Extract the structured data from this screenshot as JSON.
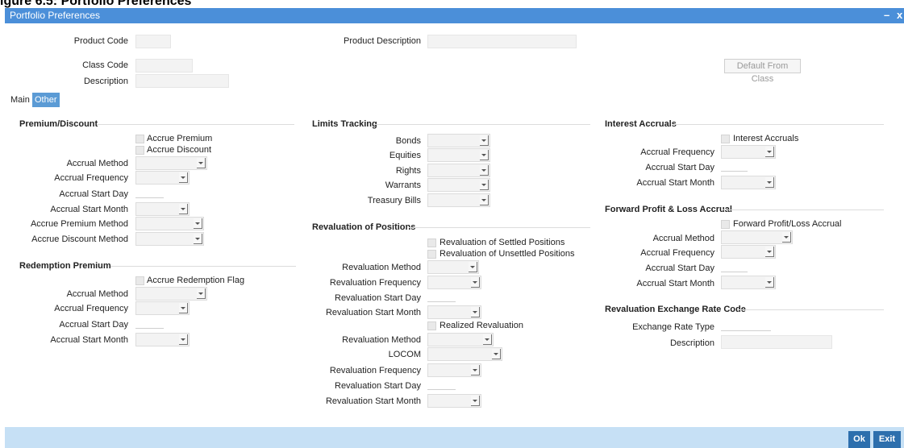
{
  "caption": "igure 6.5: Portfolio Preferences",
  "window": {
    "title": "Portfolio Preferences",
    "minimize": "–",
    "close": "x"
  },
  "header": {
    "product_code_label": "Product Code",
    "product_description_label": "Product Description",
    "class_code_label": "Class Code",
    "description_label": "Description",
    "default_from_class": "Default From Class"
  },
  "tabs": [
    {
      "label": "Main"
    },
    {
      "label": "Other"
    }
  ],
  "premium_discount": {
    "title": "Premium/Discount",
    "accrue_premium": "Accrue Premium",
    "accrue_discount": "Accrue Discount",
    "accrual_method": "Accrual Method",
    "accrual_frequency": "Accrual Frequency",
    "accrual_start_day": "Accrual Start Day",
    "accrual_start_month": "Accrual Start Month",
    "accrue_premium_method": "Accrue Premium Method",
    "accrue_discount_method": "Accrue Discount Method"
  },
  "redemption_premium": {
    "title": "Redemption Premium",
    "accrue_redemption_flag": "Accrue Redemption Flag",
    "accrual_method": "Accrual Method",
    "accrual_frequency": "Accrual Frequency",
    "accrual_start_day": "Accrual Start Day",
    "accrual_start_month": "Accrual Start Month"
  },
  "limits_tracking": {
    "title": "Limits Tracking",
    "bonds": "Bonds",
    "equities": "Equities",
    "rights": "Rights",
    "warrants": "Warrants",
    "treasury_bills": "Treasury Bills"
  },
  "revaluation": {
    "title": "Revaluation of Positions",
    "settled": "Revaluation of Settled Positions",
    "unsettled": "Revaluation of Unsettled Positions",
    "method": "Revaluation Method",
    "frequency": "Revaluation Frequency",
    "start_day": "Revaluation Start Day",
    "start_month": "Revaluation Start Month",
    "realized": "Realized Revaluation",
    "r_method": "Revaluation Method",
    "locom": "LOCOM",
    "r_frequency": "Revaluation Frequency",
    "r_start_day": "Revaluation Start Day",
    "r_start_month": "Revaluation Start Month"
  },
  "interest_accruals": {
    "title": "Interest Accruals",
    "checkbox": "Interest Accruals",
    "accrual_frequency": "Accrual Frequency",
    "accrual_start_day": "Accrual Start Day",
    "accrual_start_month": "Accrual Start Month"
  },
  "forward_pl": {
    "title": "Forward Profit & Loss Accrual",
    "checkbox": "Forward Profit/Loss Accrual",
    "accrual_method": "Accrual Method",
    "accrual_frequency": "Accrual Frequency",
    "accrual_start_day": "Accrual Start Day",
    "accrual_start_month": "Accrual Start Month"
  },
  "rate_code": {
    "title": "Revaluation Exchange Rate Code",
    "exchange_rate_type": "Exchange Rate Type",
    "description": "Description"
  },
  "footer": {
    "ok": "Ok",
    "exit": "Exit"
  }
}
